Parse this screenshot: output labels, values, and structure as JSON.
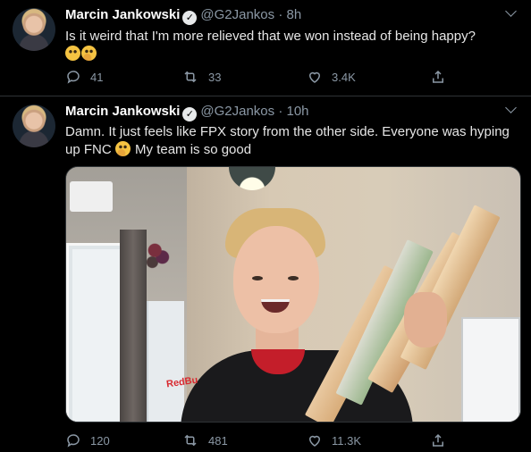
{
  "tweets": [
    {
      "name": "Marcin Jankowski",
      "handle": "@G2Jankos",
      "dot": "·",
      "time": "8h",
      "text": "Is it weird that I'm more relieved that we won instead of being happy?",
      "emojis": [
        "grinning-sweat",
        "thinking-face"
      ],
      "reply_count": "41",
      "retweet_count": "33",
      "like_count": "3.4K"
    },
    {
      "name": "Marcin Jankowski",
      "handle": "@G2Jankos",
      "dot": "·",
      "time": "10h",
      "text_part1": "Damn. It just feels like FPX story from the other side. Everyone was hyping up FNC",
      "text_part2": "My team is so good",
      "emojis": [
        "thinking-face"
      ],
      "media_logo_text": "RedBu",
      "reply_count": "120",
      "retweet_count": "481",
      "like_count": "11.3K"
    }
  ],
  "colors": {
    "background": "#000000",
    "text": "#e6e6e6",
    "secondary": "#8b98a5",
    "divider": "#2f3336"
  },
  "icons": [
    "reply-icon",
    "retweet-icon",
    "like-icon",
    "share-icon",
    "verified-badge-icon",
    "chevron-down-icon"
  ]
}
